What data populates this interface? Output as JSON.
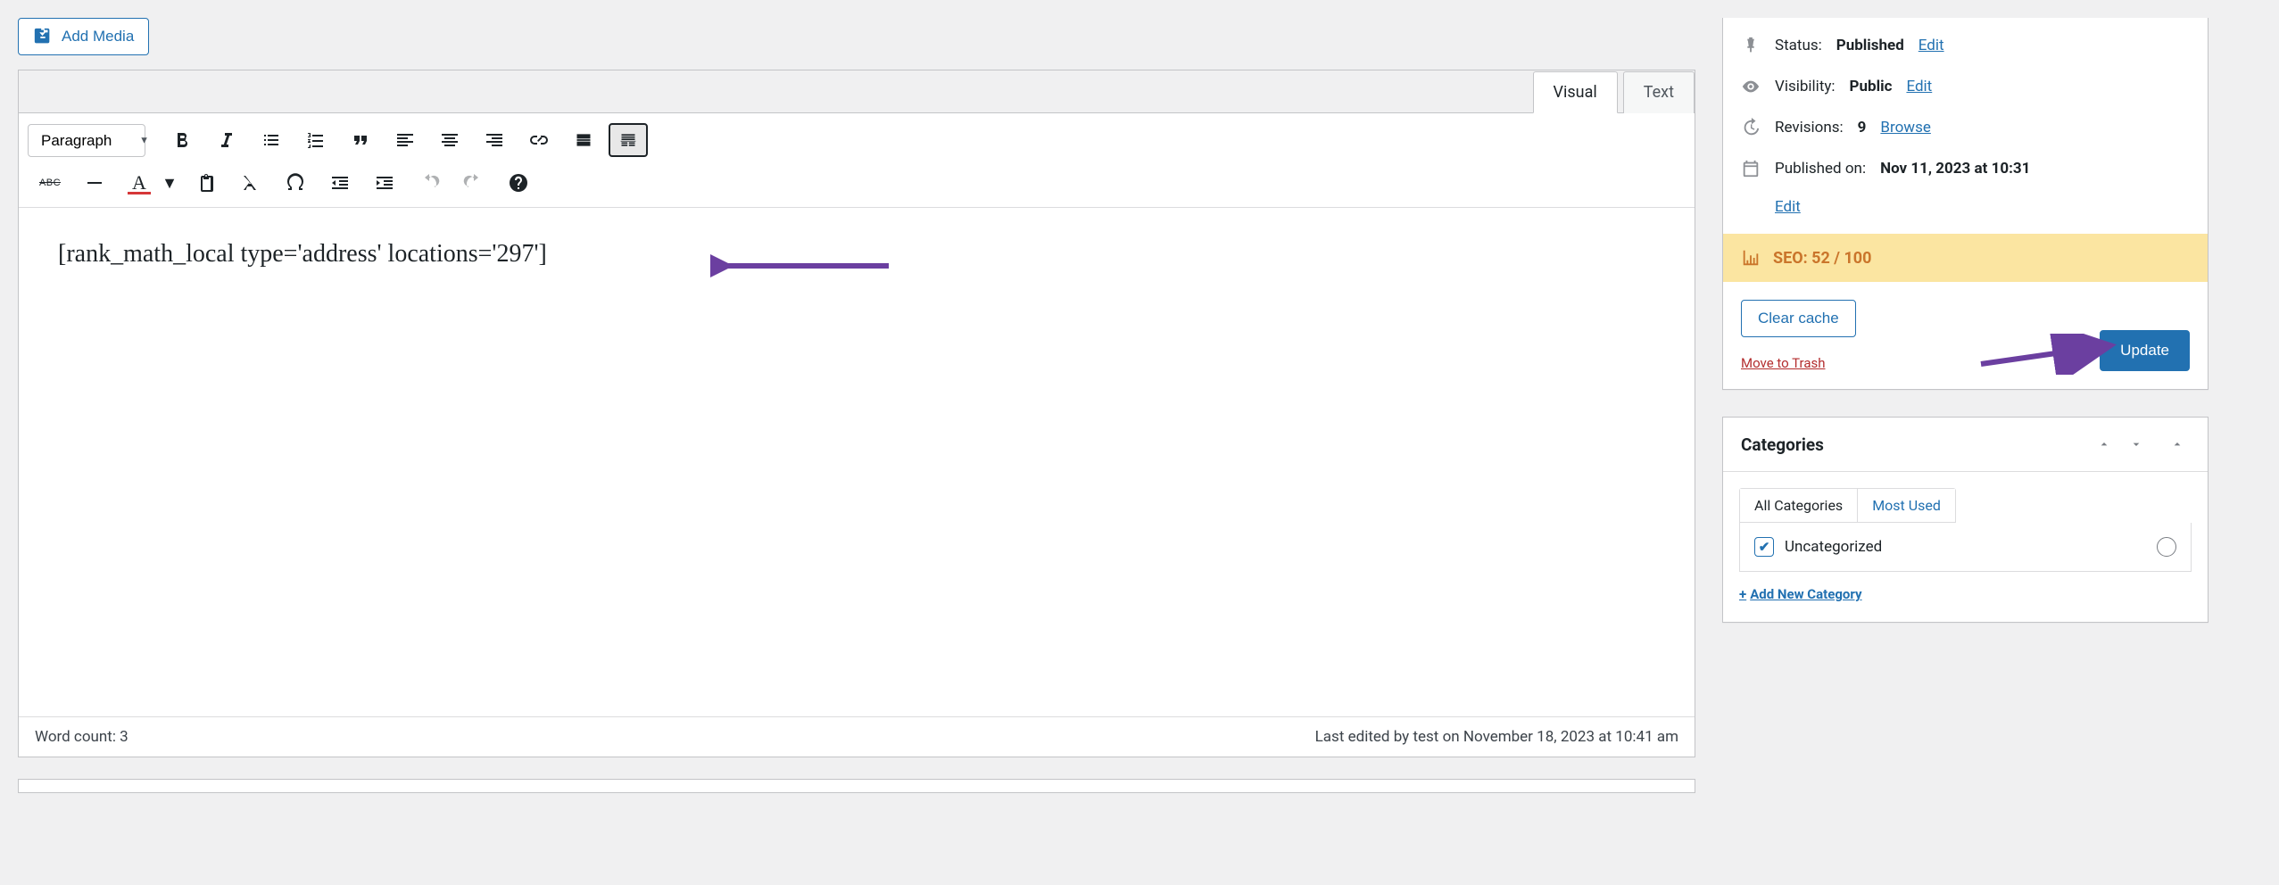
{
  "toolbar": {
    "add_media_label": "Add Media",
    "format_selected": "Paragraph"
  },
  "editor": {
    "tabs": {
      "visual": "Visual",
      "text": "Text"
    },
    "content": "[rank_math_local type='address' locations='297']",
    "word_count_label": "Word count: 3",
    "last_edited": "Last edited by test on November 18, 2023 at 10:41 am"
  },
  "publish": {
    "status_label": "Status:",
    "status_value": "Published",
    "status_edit": "Edit",
    "visibility_label": "Visibility:",
    "visibility_value": "Public",
    "visibility_edit": "Edit",
    "revisions_label": "Revisions:",
    "revisions_value": "9",
    "revisions_browse": "Browse",
    "published_on_label": "Published on:",
    "published_on_value": "Nov 11, 2023 at 10:31",
    "published_on_edit": "Edit",
    "seo_label": "SEO: 52 / 100",
    "clear_cache": "Clear cache",
    "move_to_trash": "Move to Trash",
    "update": "Update"
  },
  "categories": {
    "title": "Categories",
    "tab_all": "All Categories",
    "tab_most_used": "Most Used",
    "item_label": "Uncategorized",
    "add_new": "Add New Category"
  }
}
